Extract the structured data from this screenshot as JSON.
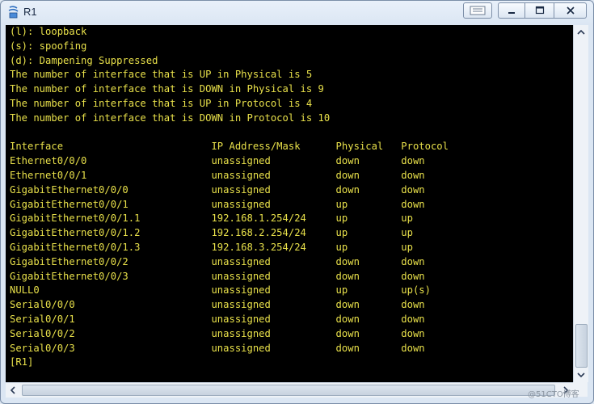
{
  "window": {
    "title": "R1",
    "icon": "router-app-icon",
    "controls": {
      "minimize": "minimize-icon",
      "maximize": "maximize-icon",
      "close": "close-icon"
    }
  },
  "terminal": {
    "lines": [
      "(l): loopback",
      "(s): spoofing",
      "(d): Dampening Suppressed",
      "The number of interface that is UP in Physical is 5",
      "The number of interface that is DOWN in Physical is 9",
      "The number of interface that is UP in Protocol is 4",
      "The number of interface that is DOWN in Protocol is 10",
      "",
      "Interface                         IP Address/Mask      Physical   Protocol",
      "Ethernet0/0/0                     unassigned           down       down",
      "Ethernet0/0/1                     unassigned           down       down",
      "GigabitEthernet0/0/0              unassigned           down       down",
      "GigabitEthernet0/0/1              unassigned           up         down",
      "GigabitEthernet0/0/1.1            192.168.1.254/24     up         up",
      "GigabitEthernet0/0/1.2            192.168.2.254/24     up         up",
      "GigabitEthernet0/0/1.3            192.168.3.254/24     up         up",
      "GigabitEthernet0/0/2              unassigned           down       down",
      "GigabitEthernet0/0/3              unassigned           down       down",
      "NULL0                             unassigned           up         up(s)",
      "Serial0/0/0                       unassigned           down       down",
      "Serial0/0/1                       unassigned           down       down",
      "Serial0/0/2                       unassigned           down       down",
      "Serial0/0/3                       unassigned           down       down",
      "[R1]"
    ],
    "text_color": "#e8e04a",
    "background_color": "#000000"
  },
  "watermark": "@51CTO博客"
}
